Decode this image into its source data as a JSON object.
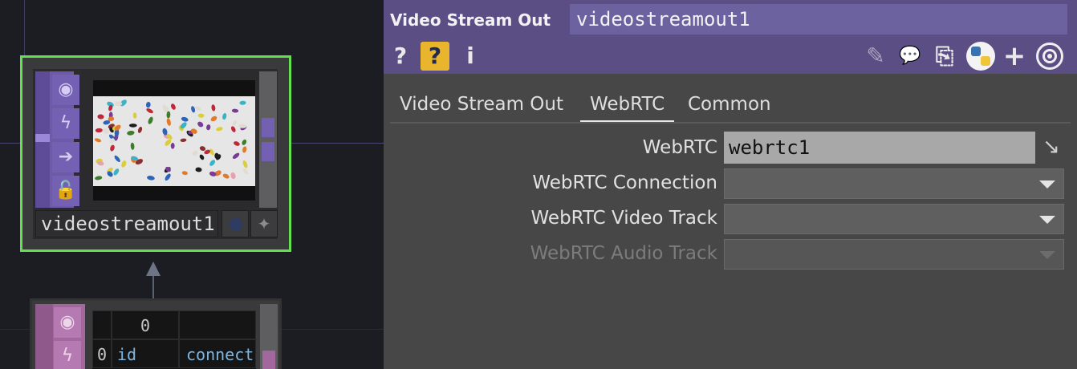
{
  "network": {
    "node_main": {
      "name": "videostreamout1",
      "side_buttons": [
        "viewer-icon",
        "bypass-icon",
        "export-icon",
        "lock-icon"
      ]
    },
    "node_table": {
      "side_buttons": [
        "viewer-icon",
        "bypass-icon"
      ],
      "header_cells": [
        "",
        "0",
        ""
      ],
      "row0": [
        "0",
        "id",
        "connect:"
      ]
    }
  },
  "panel": {
    "op_type": "Video Stream Out",
    "op_name": "videostreamout1",
    "toolbar_left": [
      {
        "icon": "help-icon",
        "glyph": "?"
      },
      {
        "icon": "python-help-icon",
        "glyph": "?"
      },
      {
        "icon": "info-icon",
        "glyph": "i"
      }
    ],
    "toolbar_right": [
      {
        "icon": "edit-icon",
        "glyph": "✎"
      },
      {
        "icon": "comment-icon",
        "glyph": "💬"
      },
      {
        "icon": "compare-icon",
        "glyph": "⎘"
      },
      {
        "icon": "python-icon"
      },
      {
        "icon": "add-icon",
        "glyph": "+"
      },
      {
        "icon": "target-icon"
      }
    ],
    "tabs": [
      "Video Stream Out",
      "WebRTC",
      "Common"
    ],
    "active_tab": "WebRTC",
    "params": [
      {
        "label": "WebRTC",
        "kind": "field",
        "value": "webrtc1",
        "enabled": true
      },
      {
        "label": "WebRTC Connection",
        "kind": "menu",
        "value": "",
        "enabled": true
      },
      {
        "label": "WebRTC Video Track",
        "kind": "menu",
        "value": "",
        "enabled": true
      },
      {
        "label": "WebRTC Audio Track",
        "kind": "menu",
        "value": "",
        "enabled": false
      }
    ]
  },
  "colors": {
    "selection": "#63e04e",
    "header": "#5a4e85",
    "top_color": "#6e5aa7",
    "dat_color": "#a2689e"
  }
}
